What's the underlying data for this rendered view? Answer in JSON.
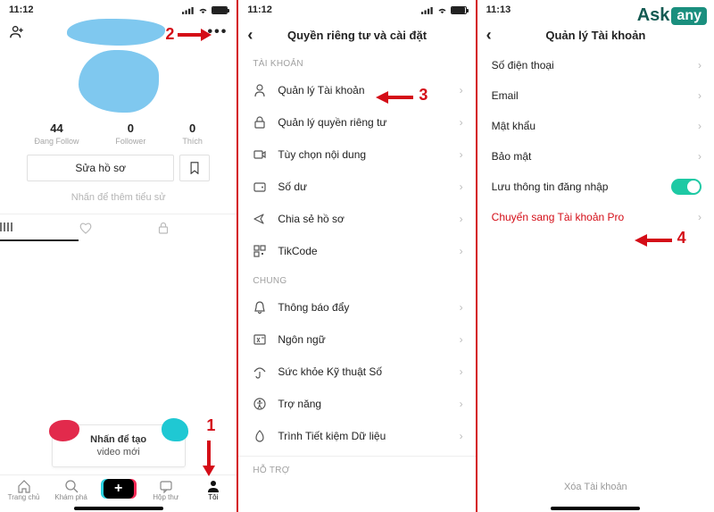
{
  "logo": {
    "part1": "Ask",
    "part2": "any"
  },
  "annotations": {
    "n1": "1",
    "n2": "2",
    "n3": "3",
    "n4": "4"
  },
  "panel1": {
    "time": "11:12",
    "more": "•••",
    "stats": [
      {
        "num": "44",
        "label": "Đang Follow"
      },
      {
        "num": "0",
        "label": "Follower"
      },
      {
        "num": "0",
        "label": "Thích"
      }
    ],
    "edit_profile": "Sửa hồ sơ",
    "bio_hint": "Nhấn để thêm tiểu sử",
    "create_title": "Nhấn để tạo",
    "create_sub": "video mới",
    "nav": [
      {
        "label": "Trang chủ"
      },
      {
        "label": "Khám phá"
      },
      {
        "label": ""
      },
      {
        "label": "Hộp thư"
      },
      {
        "label": "Tôi"
      }
    ]
  },
  "panel2": {
    "time": "11:12",
    "title": "Quyền riêng tư và cài đặt",
    "sec_account": "TÀI KHOẢN",
    "items_account": [
      "Quản lý Tài khoản",
      "Quản lý quyền riêng tư",
      "Tùy chọn nội dung",
      "Số dư",
      "Chia sẻ hồ sơ",
      "TikCode"
    ],
    "sec_general": "CHUNG",
    "items_general": [
      "Thông báo đẩy",
      "Ngôn ngữ",
      "Sức khỏe Kỹ thuật Số",
      "Trợ năng",
      "Trình Tiết kiệm Dữ liệu"
    ],
    "sec_support": "HỖ TRỢ"
  },
  "panel3": {
    "time": "11:13",
    "title": "Quản lý Tài khoản",
    "items": [
      {
        "label": "Số điện thoại"
      },
      {
        "label": "Email"
      },
      {
        "label": "Mật khẩu"
      },
      {
        "label": "Bảo mật"
      }
    ],
    "save_login": "Lưu thông tin đăng nhập",
    "pro_account": "Chuyển sang Tài khoản Pro",
    "delete": "Xóa Tài khoản"
  }
}
